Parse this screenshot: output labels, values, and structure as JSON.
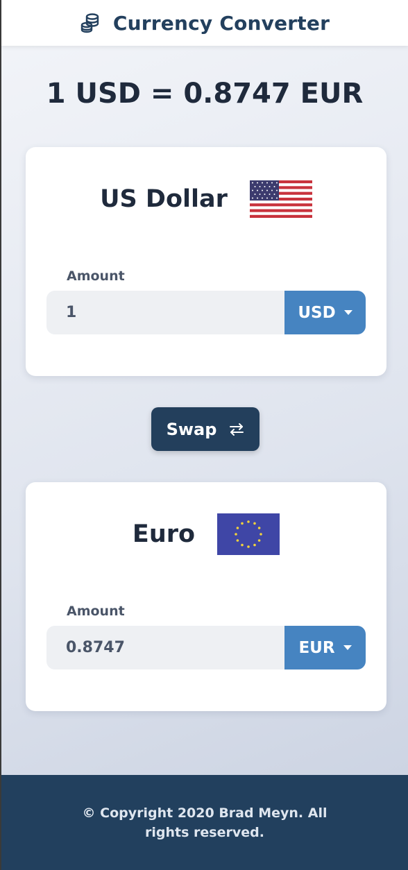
{
  "header": {
    "title": "Currency Converter",
    "icon": "coins-icon"
  },
  "rate": {
    "text": "1 USD = 0.8747 EUR"
  },
  "from": {
    "currency_name": "US Dollar",
    "flag": "us-flag-icon",
    "amount_label": "Amount",
    "amount_value": "1",
    "currency_code": "USD"
  },
  "swap": {
    "label": "Swap",
    "icon": "swap-arrows-icon"
  },
  "to": {
    "currency_name": "Euro",
    "flag": "eu-flag-icon",
    "amount_label": "Amount",
    "amount_value": "0.8747",
    "currency_code": "EUR"
  },
  "footer": {
    "copyright": "© Copyright 2020 Brad Meyn. All rights reserved."
  },
  "colors": {
    "header_text": "#23405e",
    "select_bg": "#4684c1",
    "swap_bg": "#233f5c",
    "footer_bg": "#22405e"
  }
}
